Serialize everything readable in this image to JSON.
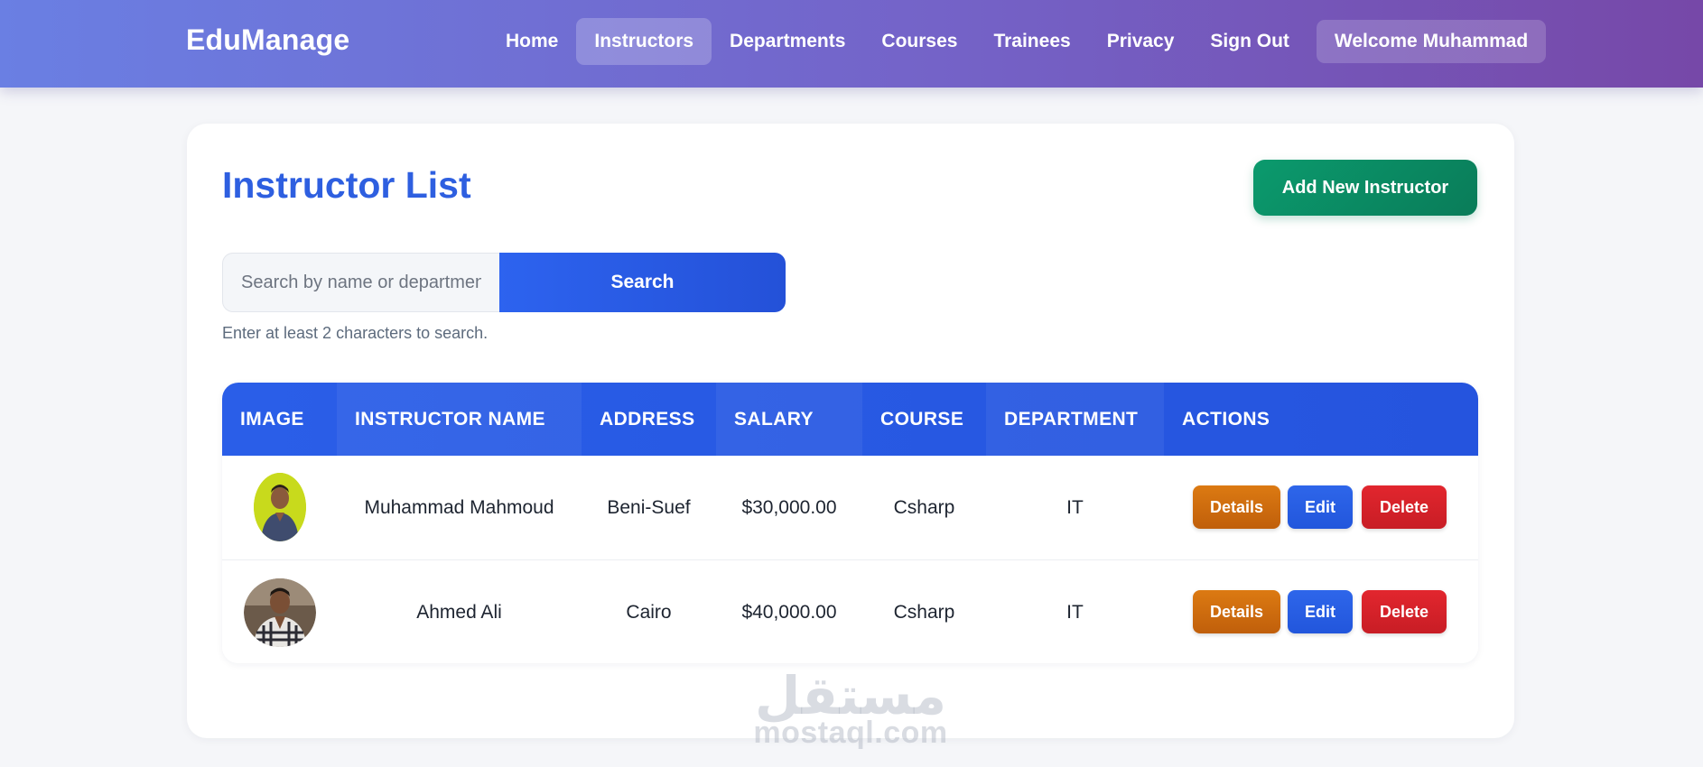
{
  "navbar": {
    "brand": "EduManage",
    "links": [
      {
        "label": "Home",
        "active": false
      },
      {
        "label": "Instructors",
        "active": true
      },
      {
        "label": "Departments",
        "active": false
      },
      {
        "label": "Courses",
        "active": false
      },
      {
        "label": "Trainees",
        "active": false
      },
      {
        "label": "Privacy",
        "active": false
      },
      {
        "label": "Sign Out",
        "active": false
      }
    ],
    "welcome": "Welcome Muhammad"
  },
  "page": {
    "title": "Instructor List",
    "add_button": "Add New Instructor"
  },
  "search": {
    "placeholder": "Search by name or department",
    "button": "Search",
    "hint": "Enter at least 2 characters to search."
  },
  "table": {
    "columns": [
      "IMAGE",
      "INSTRUCTOR NAME",
      "ADDRESS",
      "SALARY",
      "COURSE",
      "DEPARTMENT",
      "ACTIONS"
    ],
    "rows": [
      {
        "name": "Muhammad Mahmoud",
        "address": "Beni-Suef",
        "salary": "$30,000.00",
        "course": "Csharp",
        "department": "IT"
      },
      {
        "name": "Ahmed Ali",
        "address": "Cairo",
        "salary": "$40,000.00",
        "course": "Csharp",
        "department": "IT"
      }
    ],
    "actions": {
      "details": "Details",
      "edit": "Edit",
      "delete": "Delete"
    }
  },
  "watermark": {
    "arabic": "مستقل",
    "latin": "mostaql.com"
  },
  "colors": {
    "navbar_start": "#6a7fe3",
    "navbar_end": "#7648a8",
    "title": "#2e5fe0",
    "add_button": "#0a8a62",
    "primary": "#2a5ee8",
    "details": "#d06e10",
    "delete": "#d52229"
  }
}
